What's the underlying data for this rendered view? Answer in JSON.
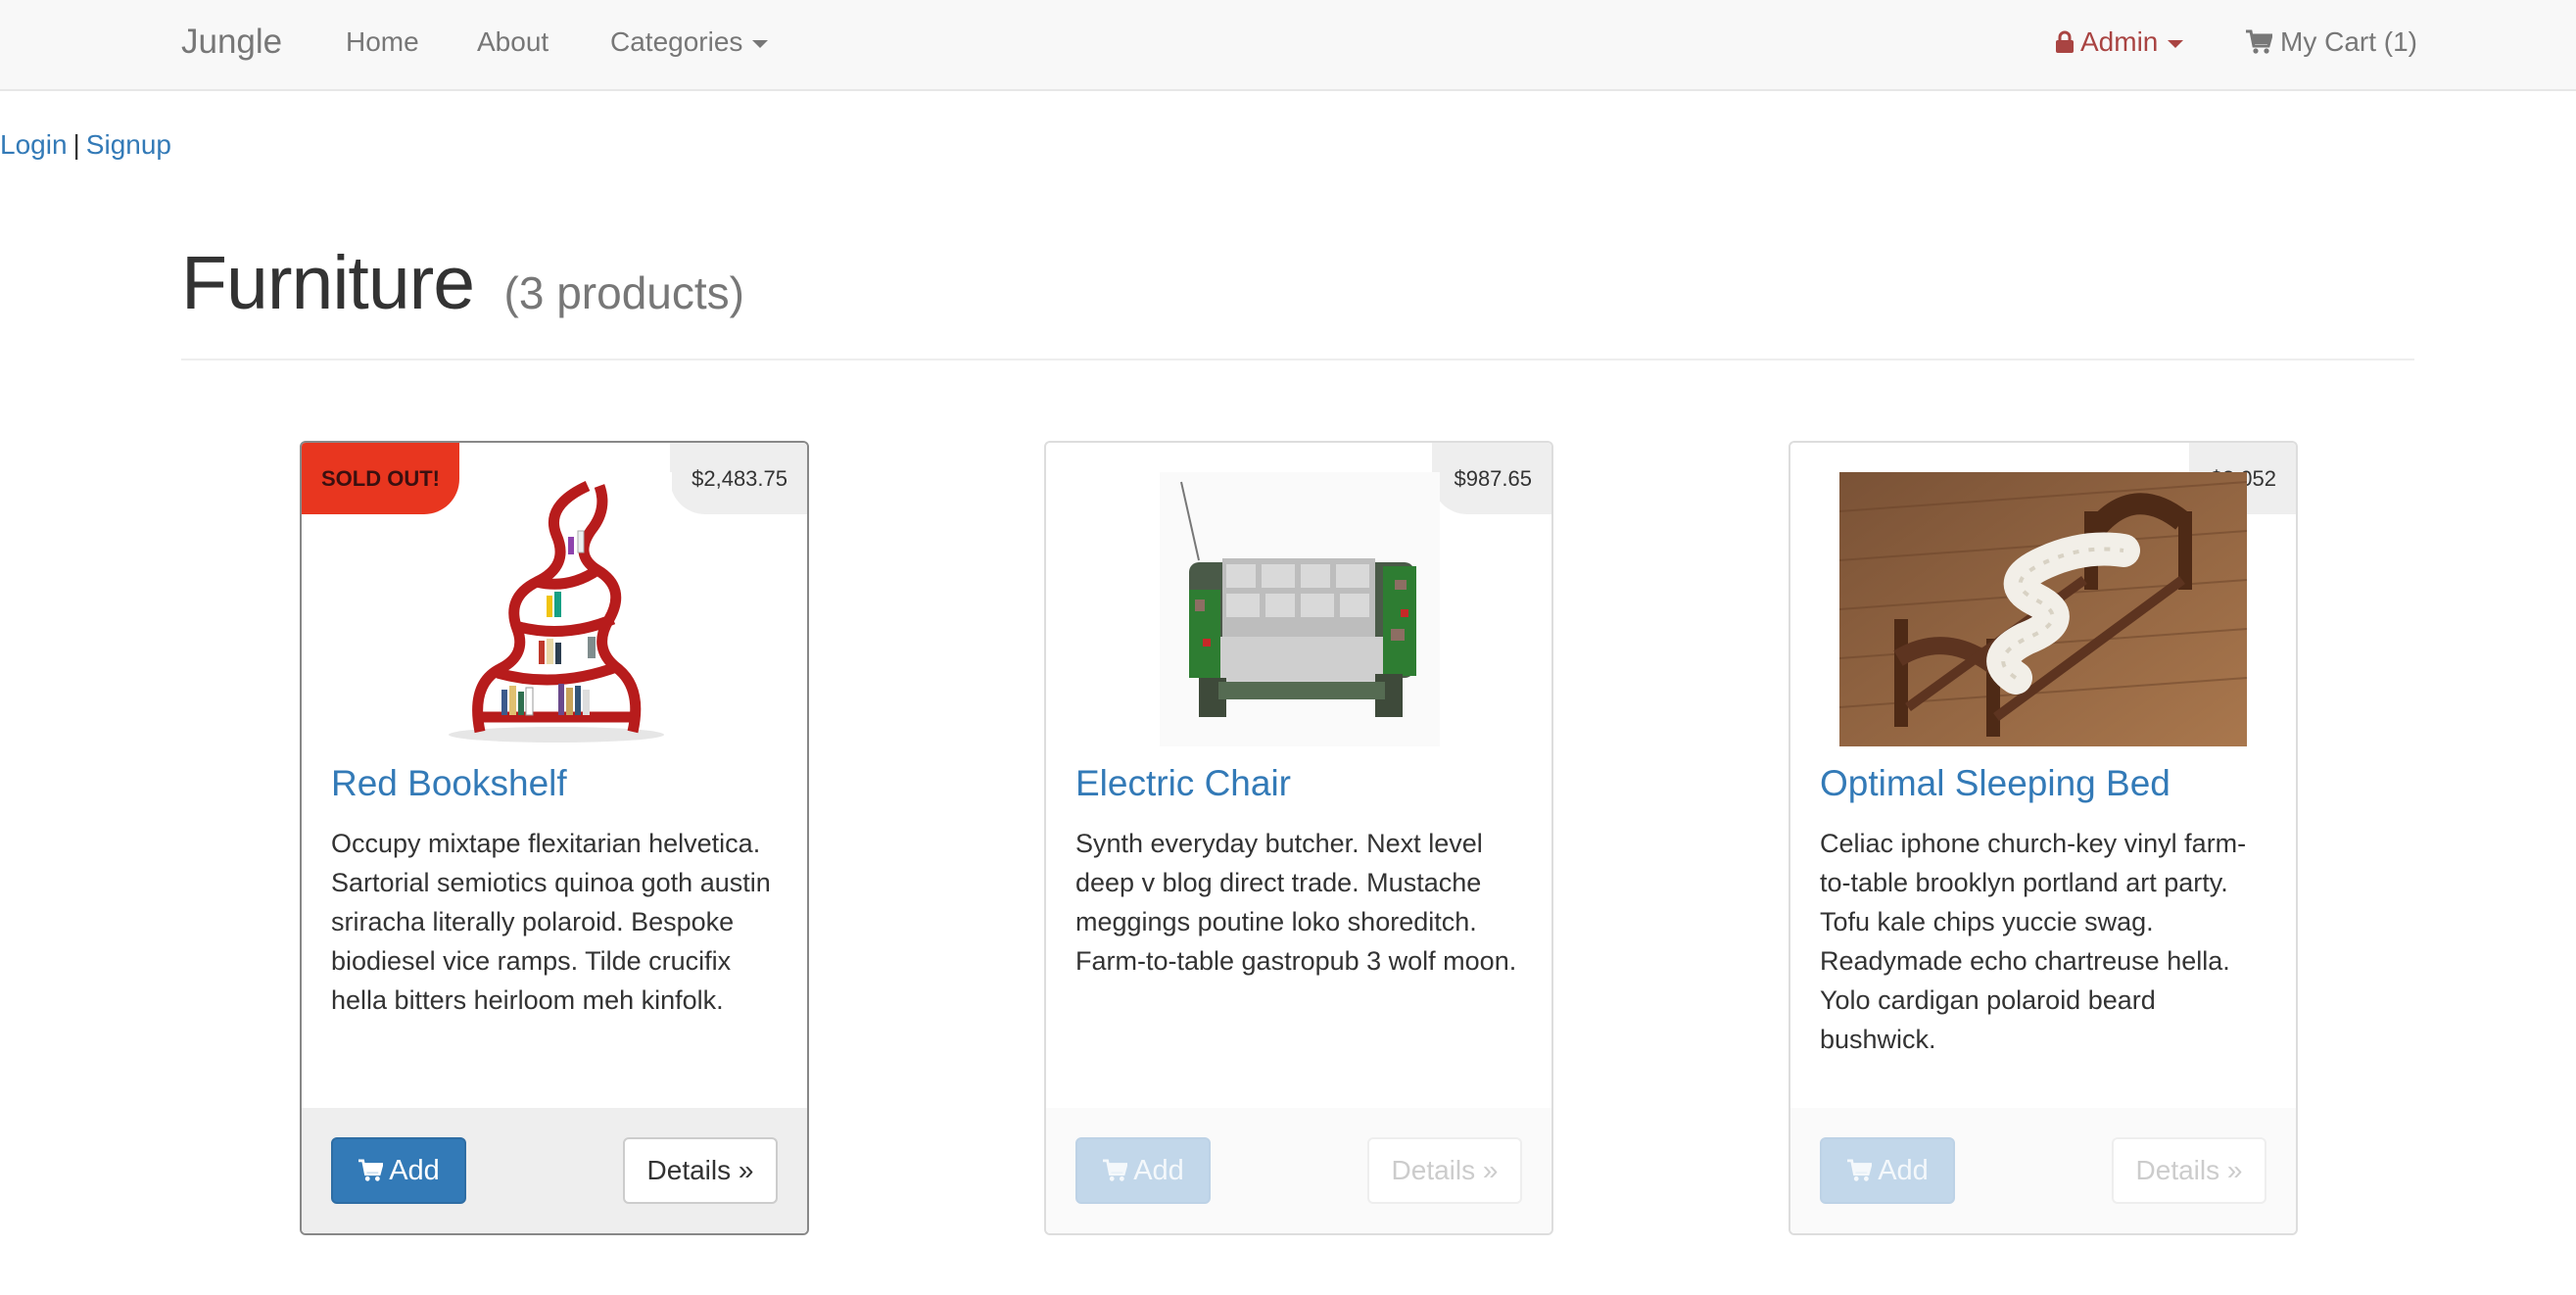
{
  "navbar": {
    "brand": "Jungle",
    "home": "Home",
    "about": "About",
    "categories": "Categories",
    "admin": "Admin",
    "cart": "My Cart (1)",
    "colors": {
      "background": "#f8f8f8",
      "link": "#777777",
      "admin": "#a94442"
    }
  },
  "auth": {
    "login": "Login",
    "separator": "|",
    "signup": "Signup"
  },
  "page": {
    "title": "Furniture",
    "count": "(3 products)"
  },
  "products": [
    {
      "name": "Red Bookshelf",
      "price": "$2,483.75",
      "badge": "SOLD OUT!",
      "description": "Occupy mixtape flexitarian helvetica. Sartorial semiotics quinoa goth austin sriracha literally polaroid. Bespoke biodiesel vice ramps. Tilde crucifix hella bitters heirloom meh kinfolk.",
      "add_label": "Add",
      "details_label": "Details »",
      "image": "red-bookshelf-photo"
    },
    {
      "name": "Electric Chair",
      "price": "$987.65",
      "description": "Synth everyday butcher. Next level deep v blog direct trade. Mustache meggings poutine loko shoreditch. Farm-to-table gastropub 3 wolf moon.",
      "add_label": "Add",
      "details_label": "Details »",
      "image": "electric-chair-photo"
    },
    {
      "name": "Optimal Sleeping Bed",
      "price": "$3,052",
      "description": "Celiac iphone church-key vinyl farm-to-table brooklyn portland art party. Tofu kale chips yuccie swag. Readymade echo chartreuse hella. Yolo cardigan polaroid beard bushwick.",
      "add_label": "Add",
      "details_label": "Details »",
      "image": "sleeping-bed-photo"
    }
  ],
  "colors": {
    "primary": "#337ab7",
    "sold_out": "#e8361f",
    "text": "#333333"
  }
}
